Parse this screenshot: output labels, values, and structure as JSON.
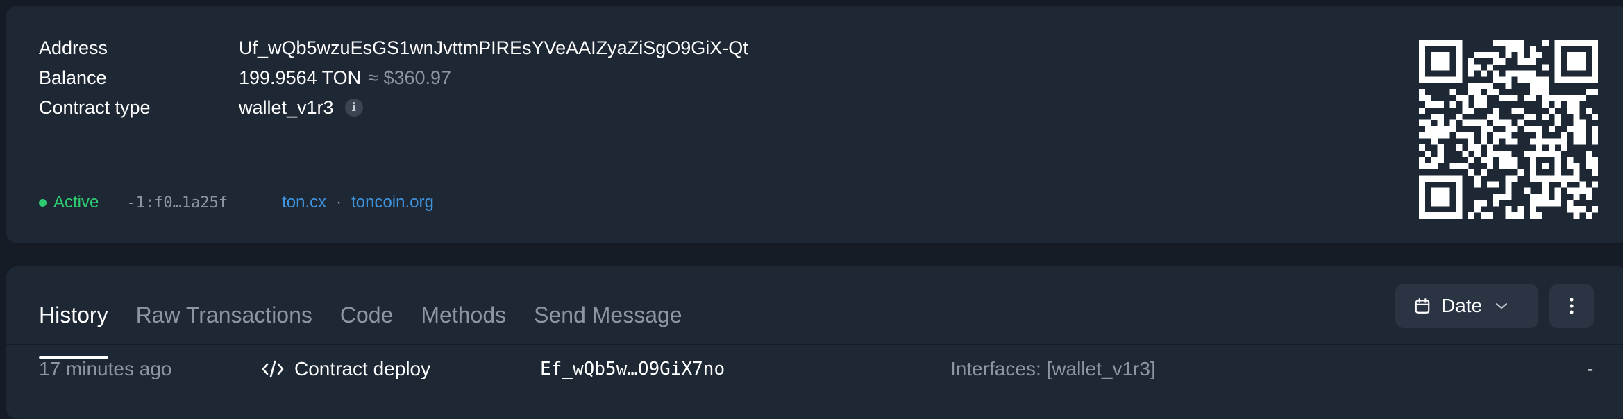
{
  "account": {
    "address_label": "Address",
    "address": "Uf_wQb5wzuEsGS1wnJvttmPIREsYVeAAIZyaZiSgO9GiX-Qt",
    "balance_label": "Balance",
    "balance": "199.9564 TON",
    "balance_fiat": "≈ $360.97",
    "contract_type_label": "Contract type",
    "contract_type": "wallet_v1r3",
    "info_icon": "i",
    "status": "Active",
    "status_color": "#2ecc71",
    "workchain": "-1:f0…1a25f",
    "links": [
      "ton.cx",
      "toncoin.org"
    ],
    "link_separator": "·",
    "link_color": "#3f95e0"
  },
  "qr_icon": "qr-code",
  "tabs": [
    {
      "label": "History",
      "active": true
    },
    {
      "label": "Raw Transactions",
      "active": false
    },
    {
      "label": "Code",
      "active": false
    },
    {
      "label": "Methods",
      "active": false
    },
    {
      "label": "Send Message",
      "active": false
    }
  ],
  "toolbar": {
    "date_label": "Date",
    "date_icon": "calendar-icon",
    "more_icon": "kebab-menu-icon"
  },
  "transactions": [
    {
      "time": "17 minutes ago",
      "type_icon": "code-icon",
      "type": "Contract deploy",
      "address": "Ef_wQb5w…O9GiX7no",
      "interfaces": "Interfaces: [wallet_v1r3]",
      "amount": "-"
    }
  ]
}
